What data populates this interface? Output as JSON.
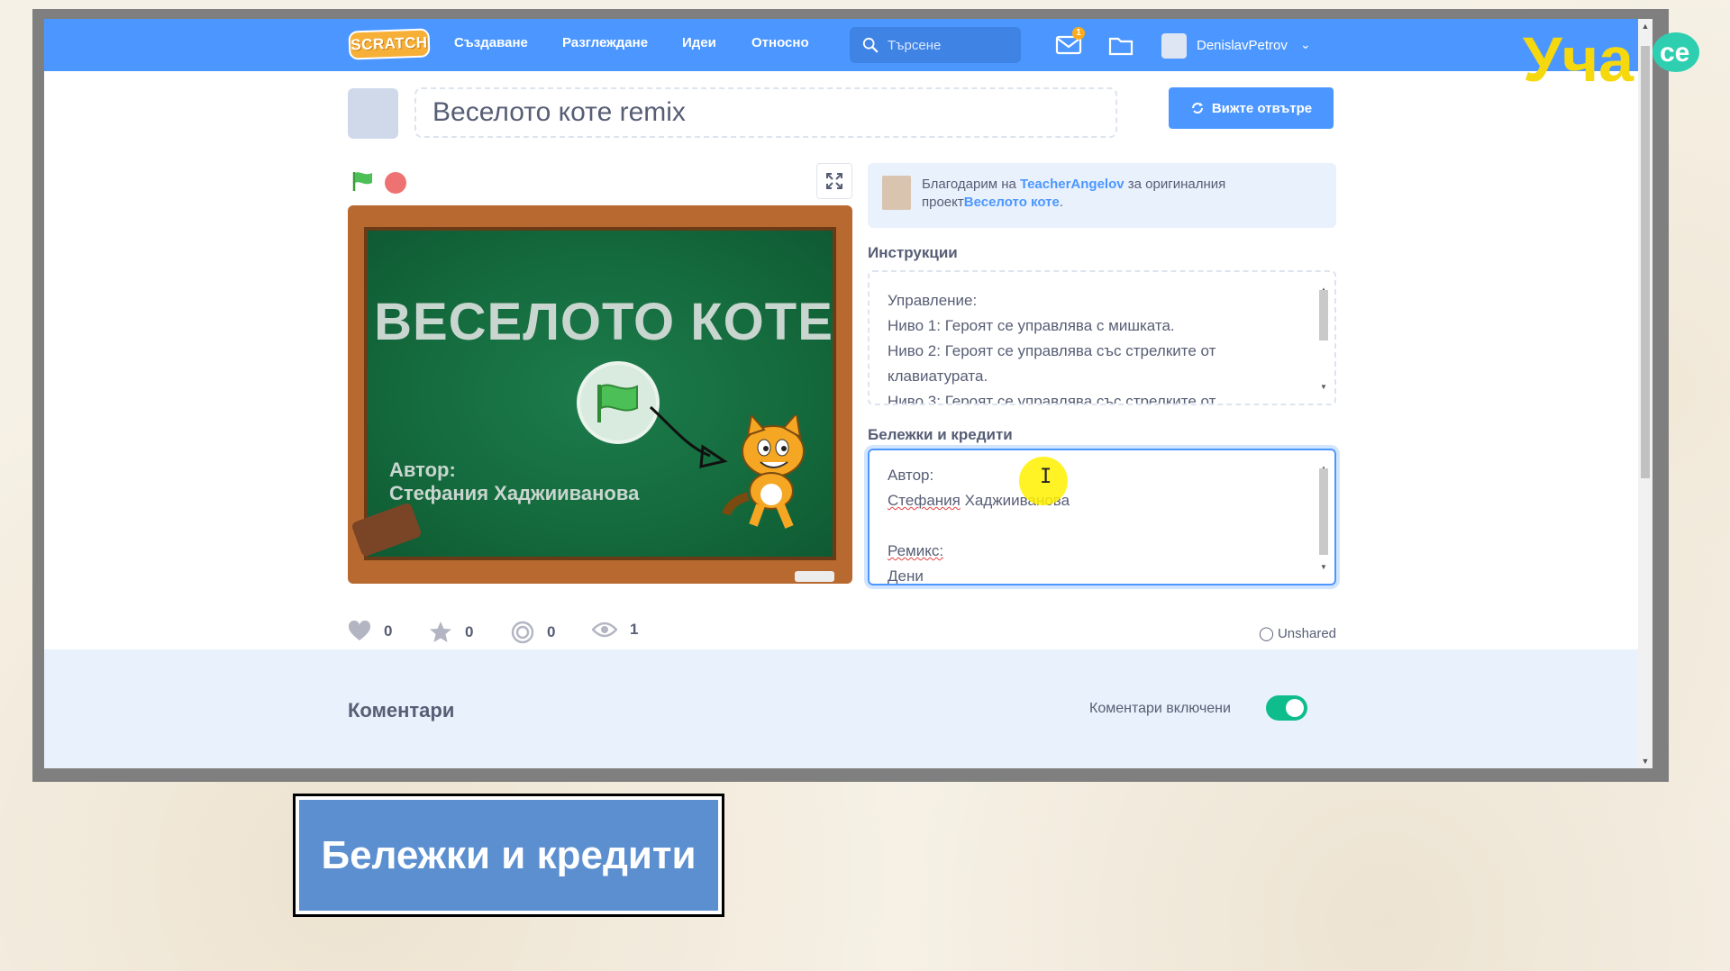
{
  "navbar": {
    "logo": "SCRATCH",
    "links": [
      "Създаване",
      "Разглеждане",
      "Идеи",
      "Относно"
    ],
    "search_placeholder": "Търсене",
    "messages_count": "1",
    "username": "DenislavPetrov"
  },
  "project": {
    "title": "Веселото коте remix",
    "see_inside_label": "Вижте отвътре"
  },
  "stage": {
    "board_title": "ВЕСЕЛОТО КОТЕ",
    "author_label": "Автор:",
    "author_name": "Стефания Хаджииванова"
  },
  "credit": {
    "prefix": "Благодарим на ",
    "user": "TeacherAngelov",
    "middle": " за оригиналния проект",
    "project": "Веселото коте",
    "suffix": "."
  },
  "instructions": {
    "label": "Инструкции",
    "lines": [
      "Управление:",
      "Ниво 1: Героят се управлява с мишката.",
      "Ниво 2: Героят се управлява със стрелките от клавиатурата.",
      "Ниво 3: Героят се управлява със стрелките от"
    ]
  },
  "notes": {
    "label": "Бележки и кредити",
    "line1": "Автор:",
    "line2_word1": "Стефания",
    "line2_word2": " Хаджииванова",
    "line4": "Ремикс:",
    "line5": "Дени"
  },
  "stats": {
    "loves": "0",
    "favorites": "0",
    "remixes": "0",
    "views": "1",
    "share_status": "Unshared"
  },
  "comments": {
    "title": "Коментари",
    "toggle_label": "Коментари включени",
    "enabled": true
  },
  "caption": "Бележки и кредити",
  "brand": "Уча се",
  "colors": {
    "scratch_blue": "#4c97ff",
    "toggle_green": "#0fbd8c",
    "board_green": "#146a3c",
    "caption_blue": "#5b8fd0"
  }
}
